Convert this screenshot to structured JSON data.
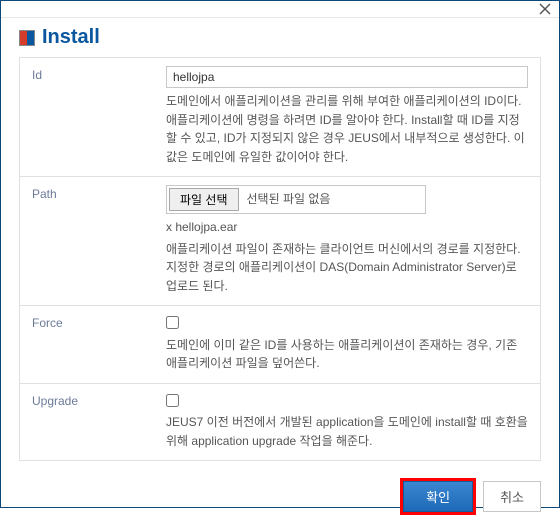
{
  "header": {
    "title": "Install"
  },
  "fields": {
    "id": {
      "label": "Id",
      "value": "hellojpa",
      "desc": "도메인에서 애플리케이션을 관리를 위해 부여한 애플리케이션의 ID이다. 애플리케이션에 명령을 하려면 ID를 알아야 한다. Install할 때 ID를 지정할 수 있고, ID가 지정되지 않은 경우 JEUS에서 내부적으로 생성한다. 이 값은 도메인에 유일한 값이어야 한다."
    },
    "path": {
      "label": "Path",
      "file_button": "파일 선택",
      "file_status": "선택된 파일 없음",
      "current_file": "x hellojpa.ear",
      "desc": "애플리케이션 파일이 존재하는 클라이언트 머신에서의 경로를 지정한다. 지정한 경로의 애플리케이션이 DAS(Domain Administrator Server)로 업로드 된다."
    },
    "force": {
      "label": "Force",
      "desc": "도메인에 이미 같은 ID를 사용하는 애플리케이션이 존재하는 경우, 기존 애플리케이션 파일을 덮어쓴다."
    },
    "upgrade": {
      "label": "Upgrade",
      "desc": "JEUS7 이전 버전에서 개발된 application을 도메인에 install할 때 호환을 위해 application upgrade 작업을 해준다."
    }
  },
  "buttons": {
    "ok": "확인",
    "cancel": "취소"
  }
}
